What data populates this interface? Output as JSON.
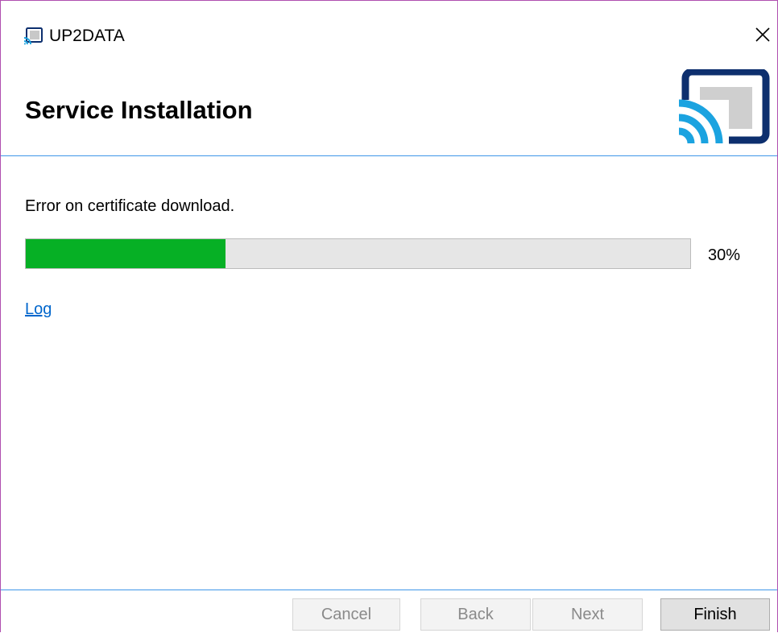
{
  "window": {
    "title": "UP2DATA",
    "close_icon": "close-icon",
    "app_icon": "cast-icon",
    "border_color": "#b04fb0"
  },
  "header": {
    "title": "Service Installation",
    "logo_icon": "cast-logo-icon",
    "divider_color": "#3f96e8"
  },
  "main": {
    "status_text": "Error on certificate download.",
    "progress": {
      "value": 0.3,
      "label": "30%",
      "fill_color": "#06b025",
      "track_color": "#e6e6e6"
    },
    "log_link": "Log"
  },
  "footer": {
    "buttons": [
      {
        "label": "Cancel",
        "enabled": false
      },
      {
        "label": "Back",
        "enabled": false
      },
      {
        "label": "Next",
        "enabled": false
      },
      {
        "label": "Finish",
        "enabled": true
      }
    ]
  }
}
